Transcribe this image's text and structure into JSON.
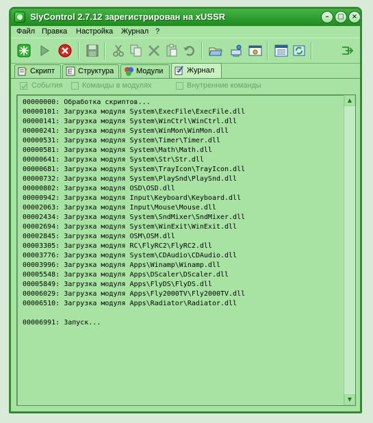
{
  "window": {
    "title": "SlyControl 2.7.12 зарегистрирован на xUSSR",
    "controls": {
      "minimize": "–",
      "maximize": "□",
      "close": "×"
    }
  },
  "menu": [
    {
      "label": "Файл"
    },
    {
      "label": "Правка"
    },
    {
      "label": "Настройка"
    },
    {
      "label": "Журнал"
    },
    {
      "label": "?"
    }
  ],
  "toolbar": [
    {
      "name": "run-settings-icon"
    },
    {
      "name": "play-icon"
    },
    {
      "name": "stop-icon"
    },
    {
      "name": "save-icon"
    },
    {
      "name": "cut-icon"
    },
    {
      "name": "copy-icon"
    },
    {
      "name": "delete-icon"
    },
    {
      "name": "paste-icon"
    },
    {
      "name": "undo-icon"
    },
    {
      "name": "open-folder-icon"
    },
    {
      "name": "network-icon"
    },
    {
      "name": "settings-window-icon"
    },
    {
      "name": "list-view-icon"
    },
    {
      "name": "refresh-icon"
    },
    {
      "name": "exit-icon"
    }
  ],
  "tabs": [
    {
      "label": "Скрипт",
      "icon": "script-icon",
      "active": false
    },
    {
      "label": "Структура",
      "icon": "structure-icon",
      "active": false
    },
    {
      "label": "Модули",
      "icon": "modules-icon",
      "active": false
    },
    {
      "label": "Журнал",
      "icon": "journal-icon",
      "active": true
    }
  ],
  "filters": [
    {
      "label": "События",
      "checked": true
    },
    {
      "label": "Команды в модулях",
      "checked": false
    },
    {
      "label": "Внутренние команды",
      "checked": false
    }
  ],
  "log": [
    "00000000: Обработка скриптов...",
    "00000101: Загрузка модуля System\\ExecFile\\ExecFile.dll",
    "00000141: Загрузка модуля System\\WinCtrl\\WinCtrl.dll",
    "00000241: Загрузка модуля System\\WinMon\\WinMon.dll",
    "00000531: Загрузка модуля System\\Timer\\Timer.dll",
    "00000581: Загрузка модуля System\\Math\\Math.dll",
    "00000641: Загрузка модуля System\\Str\\Str.dll",
    "00000681: Загрузка модуля System\\TrayIcon\\TrayIcon.dll",
    "00000732: Загрузка модуля System\\PlaySnd\\PlaySnd.dll",
    "00000802: Загрузка модуля OSD\\OSD.dll",
    "00000942: Загрузка модуля Input\\Keyboard\\Keyboard.dll",
    "00002063: Загрузка модуля Input\\Mouse\\Mouse.dll",
    "00002434: Загрузка модуля System\\SndMixer\\SndMixer.dll",
    "00002694: Загрузка модуля System\\WinExit\\WinExit.dll",
    "00002845: Загрузка модуля OSM\\OSM.dll",
    "00003305: Загрузка модуля RC\\FlyRC2\\FlyRC2.dll",
    "00003776: Загрузка модуля System\\CDAudio\\CDAudio.dll",
    "00003996: Загрузка модуля Apps\\Winamp\\Winamp.dll",
    "00005548: Загрузка модуля Apps\\DScaler\\DScaler.dll",
    "00005849: Загрузка модуля Apps\\FlyDS\\FlyDS.dll",
    "00006029: Загрузка модуля Apps\\Fly2000TV\\Fly2000TV.dll",
    "00006510: Загрузка модуля Apps\\Radiator\\Radiator.dll",
    "",
    "00006991: Запуск..."
  ],
  "colors": {
    "titlebar": "#2e8b2e",
    "window_bg": "#a8e3a3",
    "log_bg": "#a8e3a3",
    "disabled_text": "#6aa26a"
  }
}
